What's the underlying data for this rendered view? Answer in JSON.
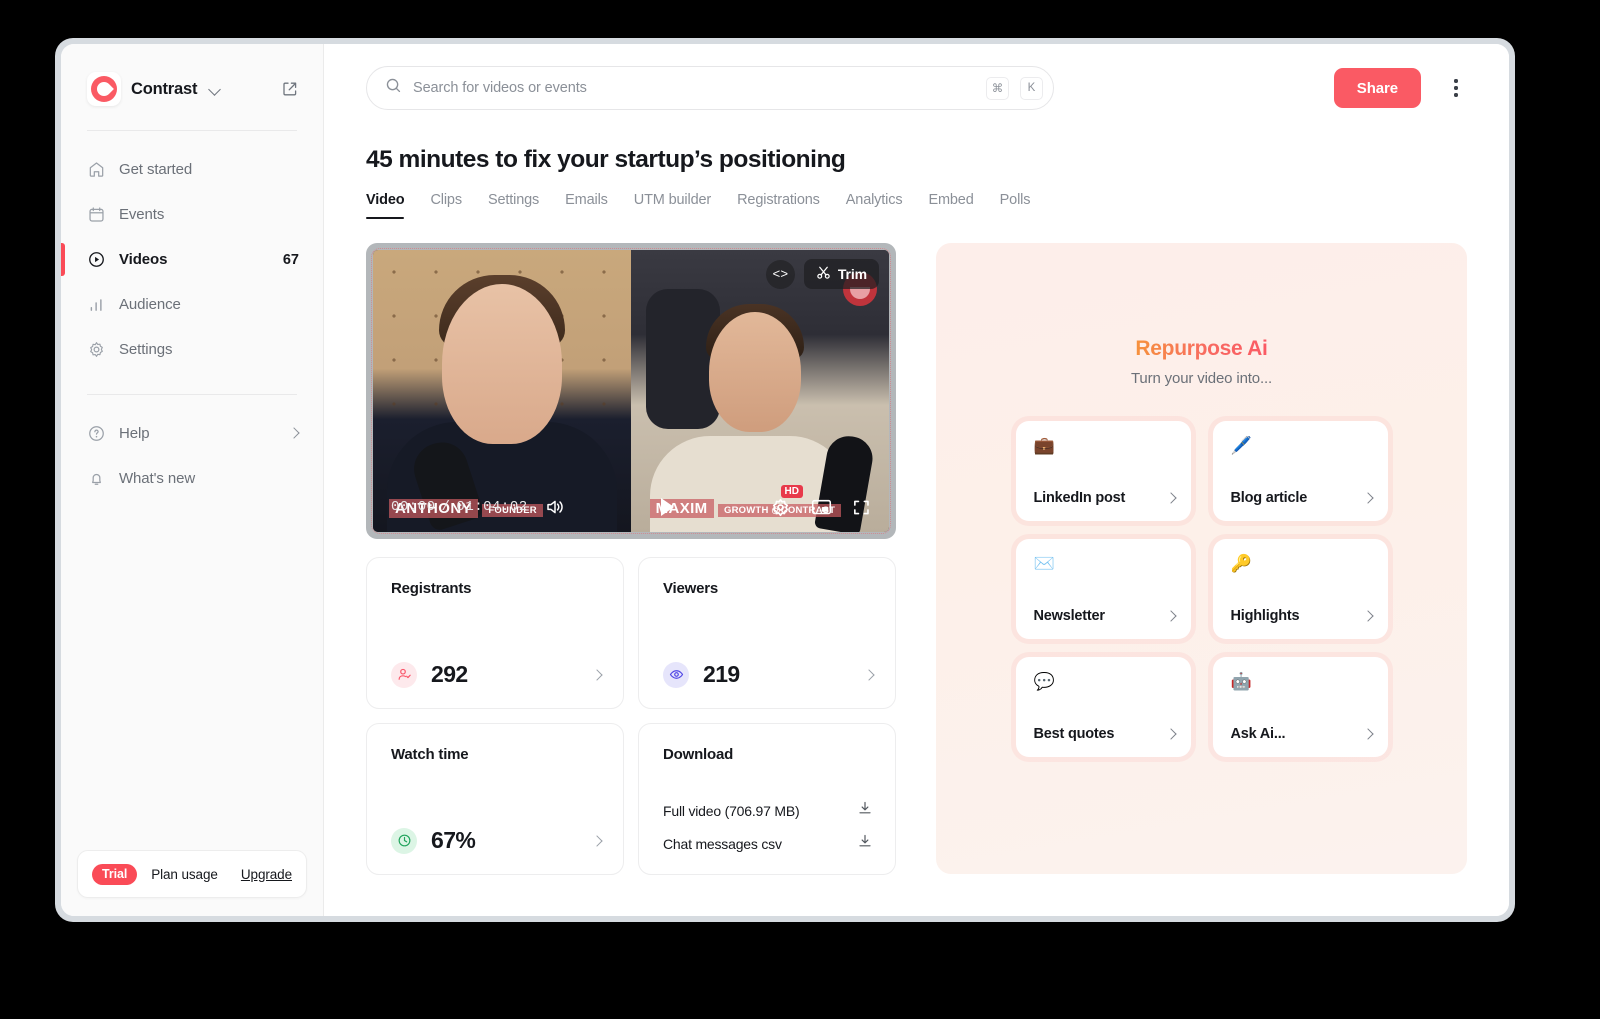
{
  "sidebar": {
    "workspace": "Contrast",
    "open_external_icon": "external-link-icon",
    "nav": [
      {
        "label": "Get started",
        "icon": "home-icon",
        "count": "",
        "active": false
      },
      {
        "label": "Events",
        "icon": "calendar-icon",
        "count": "",
        "active": false
      },
      {
        "label": "Videos",
        "icon": "play-circle-icon",
        "count": "67",
        "active": true
      },
      {
        "label": "Audience",
        "icon": "bar-chart-icon",
        "count": "",
        "active": false
      },
      {
        "label": "Settings",
        "icon": "gear-icon",
        "count": "",
        "active": false
      }
    ],
    "bottom_nav": [
      {
        "label": "Help",
        "icon": "question-circle-icon",
        "chevron": true
      },
      {
        "label": "What's new",
        "icon": "bell-icon",
        "chevron": false
      }
    ],
    "plan": {
      "badge": "Trial",
      "label": "Plan usage",
      "action": "Upgrade"
    }
  },
  "topbar": {
    "search_placeholder": "Search for videos or events",
    "search_value": "",
    "search_icon": "search-icon",
    "shortcut_keys": [
      "⌘",
      "K"
    ],
    "share_label": "Share",
    "more_icon": "kebab-menu-icon"
  },
  "page": {
    "title": "45 minutes to fix your startup’s positioning",
    "tabs": [
      {
        "label": "Video",
        "active": true
      },
      {
        "label": "Clips",
        "active": false
      },
      {
        "label": "Settings",
        "active": false
      },
      {
        "label": "Emails",
        "active": false
      },
      {
        "label": "UTM builder",
        "active": false
      },
      {
        "label": "Registrations",
        "active": false
      },
      {
        "label": "Analytics",
        "active": false
      },
      {
        "label": "Embed",
        "active": false
      },
      {
        "label": "Polls",
        "active": false
      }
    ]
  },
  "player": {
    "embed_code_label": "<>",
    "trim_label": "Trim",
    "trim_icon": "scissors-icon",
    "current_time": "00:00",
    "duration": "01:04:02",
    "time_separator": "/",
    "volume_icon": "volume-up-icon",
    "play_icon": "play-icon",
    "settings_icon": "gear-icon",
    "pip_icon": "picture-in-picture-icon",
    "fullscreen_icon": "fullscreen-icon",
    "quality_badge": "HD",
    "speaker_left": {
      "name": "ANTHONY",
      "subtitle": "FOUNDER"
    },
    "speaker_right": {
      "name": "MAXIM",
      "subtitle": "GROWTH @CONTRAST"
    }
  },
  "stats": [
    {
      "title": "Registrants",
      "value": "292",
      "icon": "user-check-icon",
      "icon_color": "#f9566a",
      "icon_bg": "#fde9ec"
    },
    {
      "title": "Viewers",
      "value": "219",
      "icon": "eye-icon",
      "icon_color": "#4f46e5",
      "icon_bg": "#e6e5fb"
    },
    {
      "title": "Watch time",
      "value": "67%",
      "icon": "clock-icon",
      "icon_color": "#22a45d",
      "icon_bg": "#dcf5e5"
    }
  ],
  "download": {
    "title": "Download",
    "items": [
      {
        "label": "Full video (706.97 MB)",
        "icon": "download-icon"
      },
      {
        "label": "Chat messages csv",
        "icon": "download-icon"
      }
    ]
  },
  "repurpose": {
    "title": "Repurpose Ai",
    "subtitle": "Turn your video into...",
    "cards": [
      {
        "label": "LinkedIn post",
        "emoji": "💼",
        "icon": "briefcase-icon"
      },
      {
        "label": "Blog article",
        "emoji": "🖊️",
        "icon": "pen-icon"
      },
      {
        "label": "Newsletter",
        "emoji": "✉️",
        "icon": "envelope-icon"
      },
      {
        "label": "Highlights",
        "emoji": "🔑",
        "icon": "key-icon"
      },
      {
        "label": "Best quotes",
        "emoji": "💬",
        "icon": "speech-bubble-icon"
      },
      {
        "label": "Ask Ai...",
        "emoji": "🤖",
        "icon": "robot-icon"
      }
    ]
  },
  "colors": {
    "brand_red": "#fa5a64",
    "accent_active": "#fa4b57",
    "repurpose_gradient_start": "#f6923c",
    "repurpose_gradient_end": "#fa5a64"
  }
}
